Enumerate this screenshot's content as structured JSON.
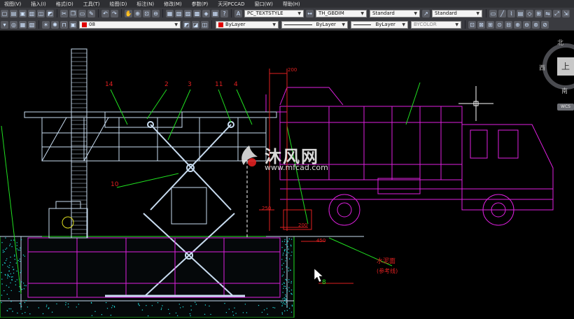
{
  "menu": [
    "视图(V)",
    "插入(I)",
    "格式(O)",
    "工具(T)",
    "绘图(D)",
    "标注(N)",
    "修改(M)",
    "参数(P)",
    "天河PCCAD",
    "窗口(W)",
    "帮助(H)"
  ],
  "toolbar1": {
    "text_style": "PC_TEXTSTYLE",
    "dim_style": "TH_GBDIM",
    "table_style": "Standard",
    "multileader_style": "Standard"
  },
  "toolbar2": {
    "layer": "08",
    "color": "ByLayer",
    "linetype": "ByLayer",
    "lineweight": "ByLayer",
    "plotstyle": "BYCOLOR",
    "color_swatch": "#e00000"
  },
  "viewcube": {
    "north": "北",
    "west": "西",
    "south": "南",
    "top": "上",
    "wcs": "WCS"
  },
  "watermark": {
    "title": "沐风网",
    "url": "www.mfcad.com"
  },
  "drawing": {
    "labels": {
      "l14": "14",
      "l2": "2",
      "l3": "3",
      "l11": "11",
      "l4": "4",
      "l10": "10",
      "l8": "8",
      "d200": "200",
      "d200b": "200",
      "d450": "450",
      "d250": "250",
      "water_level": "水泥面",
      "water_level_sub": "(参考线)"
    }
  },
  "colors": {
    "frame": "#c8dcf0",
    "truck": "#e020e0",
    "callout": "#20e020",
    "dim": "#e02020",
    "hatch": "#20e0e0"
  }
}
